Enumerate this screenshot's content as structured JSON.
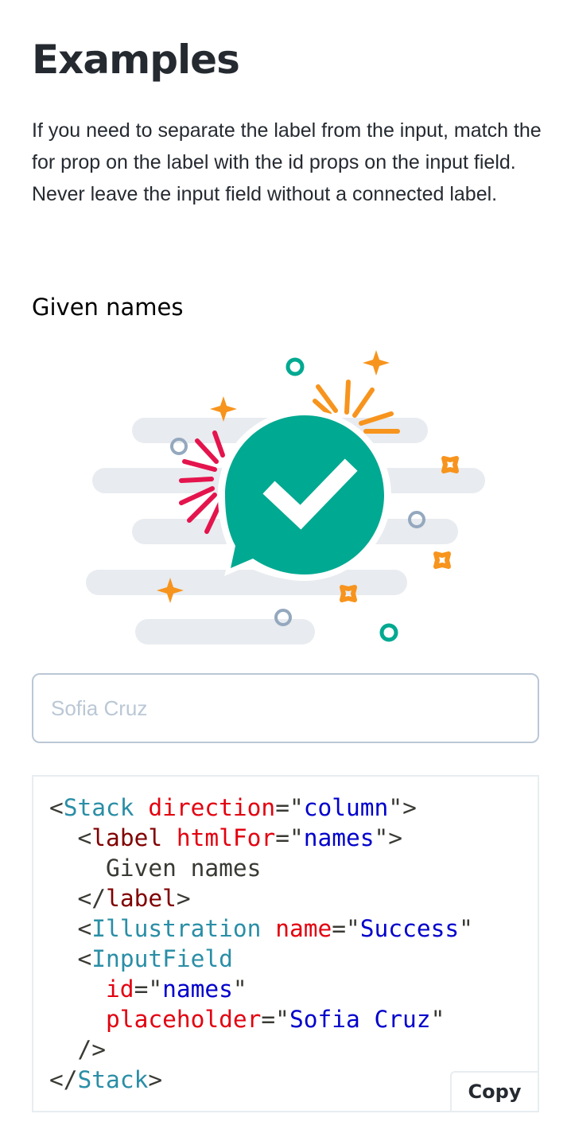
{
  "page": {
    "title": "Examples",
    "intro": "If you need to separate the label from the input, match the for prop on the label with the id props on the input field. Never leave the input field without a connected label."
  },
  "example": {
    "label": "Given names",
    "illustration_name": "success-illustration",
    "input": {
      "placeholder": "Sofia Cruz",
      "value": ""
    }
  },
  "code": {
    "line1": {
      "open": "<",
      "tag": "Stack",
      "attr": "direction",
      "eq": "=\"",
      "value": "column",
      "close": "\">"
    },
    "line2": {
      "open": "<",
      "tag": "label",
      "attr": "htmlFor",
      "eq": "=\"",
      "value": "names",
      "close": "\">"
    },
    "line3": {
      "text": "Given names"
    },
    "line4": {
      "open": "</",
      "tag": "label",
      "close": ">"
    },
    "line5": {
      "open": "<",
      "tag": "Illustration",
      "attr": "name",
      "eq": "=\"",
      "value": "Success",
      "close": "\""
    },
    "line6": {
      "open": "<",
      "tag": "InputField"
    },
    "line7": {
      "attr": "id",
      "eq": "=\"",
      "value": "names",
      "close": "\""
    },
    "line8": {
      "attr": "placeholder",
      "eq": "=\"",
      "value": "Sofia Cruz",
      "close": "\""
    },
    "line9": {
      "close": "/>"
    },
    "line10": {
      "open": "</",
      "tag": "Stack",
      "close": ">"
    }
  },
  "copy_button": {
    "label": "Copy"
  },
  "colors": {
    "accent_green": "#00a991",
    "orange": "#f7941d",
    "red": "#e4144d",
    "cloud": "#e8ebef",
    "ring_grey": "#94a8be"
  }
}
